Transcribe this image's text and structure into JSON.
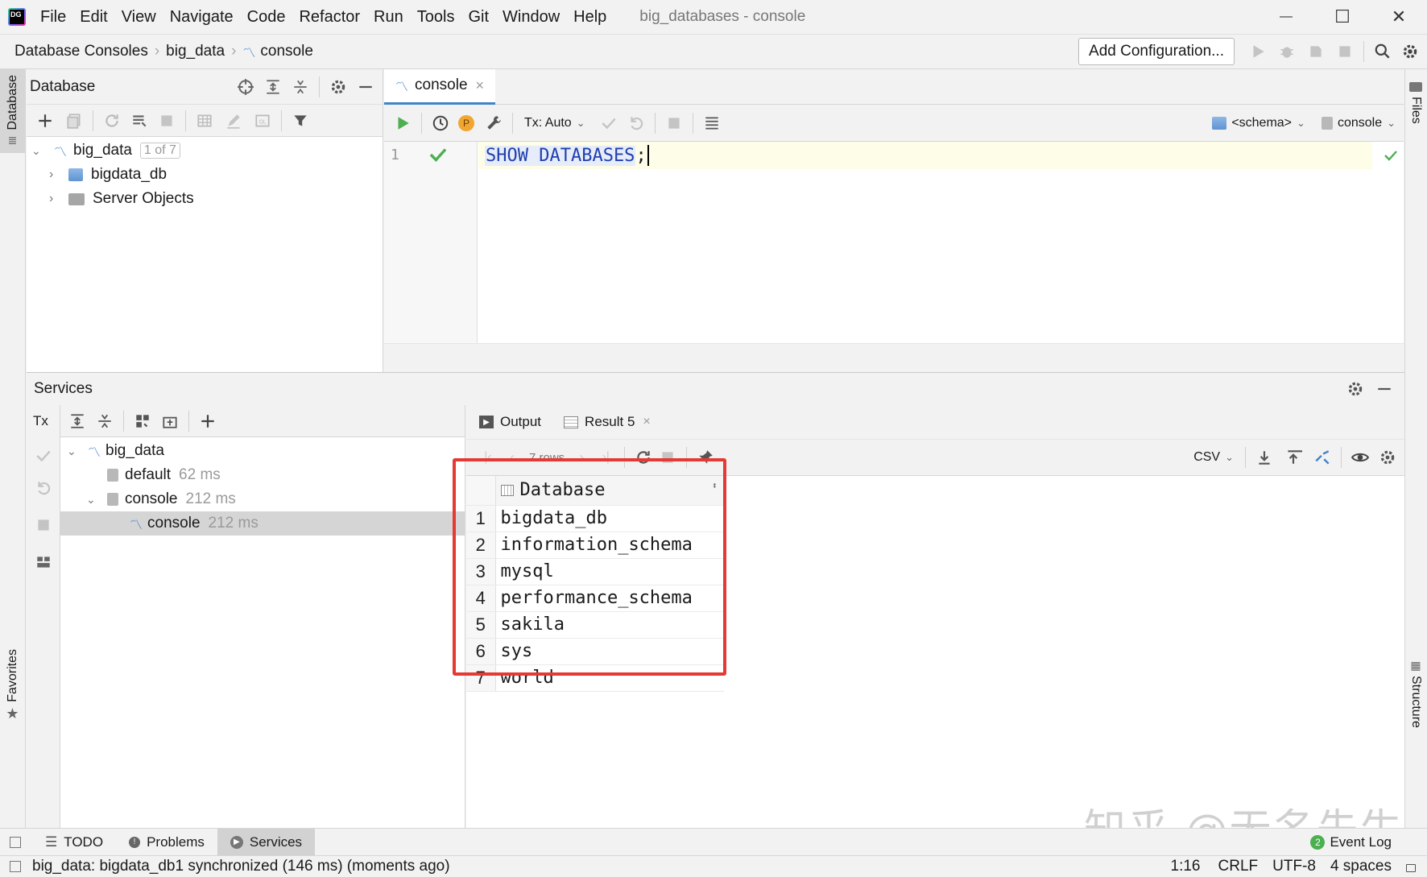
{
  "app": {
    "icon_text": "DG",
    "window_title": "big_databases - console",
    "menu": [
      "File",
      "Edit",
      "View",
      "Navigate",
      "Code",
      "Refactor",
      "Run",
      "Tools",
      "Git",
      "Window",
      "Help"
    ],
    "window_controls": {
      "minimize": "—",
      "maximize": "☐",
      "close": "✕"
    }
  },
  "navbar": {
    "breadcrumb": [
      "Database Consoles",
      "big_data",
      "console"
    ],
    "add_configuration": "Add Configuration..."
  },
  "left_strip": {
    "database": "Database",
    "favorites": "Favorites"
  },
  "right_strip": {
    "files": "Files",
    "structure": "Structure"
  },
  "db_panel": {
    "title": "Database",
    "tree": [
      {
        "label": "big_data",
        "badge": "1 of 7"
      },
      {
        "label": "bigdata_db"
      },
      {
        "label": "Server Objects"
      }
    ]
  },
  "editor": {
    "tab": "console",
    "tab_close": "×",
    "tx_mode": "Tx: Auto",
    "schema_selector": "<schema>",
    "console_selector": "console",
    "line_number": "1",
    "code": "SHOW DATABASES",
    "code_end": ";",
    "p_badge": "P"
  },
  "services": {
    "title": "Services",
    "tx_label": "Tx",
    "tree": [
      {
        "label": "big_data",
        "time": ""
      },
      {
        "label": "default",
        "time": "62 ms"
      },
      {
        "label": "console",
        "time": "212 ms"
      },
      {
        "label": "console",
        "time": "212 ms"
      }
    ],
    "result_tabs": {
      "output": "Output",
      "result": "Result 5",
      "result_close": "×"
    },
    "rows_label": "7 rows",
    "export_format": "CSV",
    "column_header": "Database",
    "rows": [
      {
        "n": "1",
        "v": "bigdata_db"
      },
      {
        "n": "2",
        "v": "information_schema"
      },
      {
        "n": "3",
        "v": "mysql"
      },
      {
        "n": "4",
        "v": "performance_schema"
      },
      {
        "n": "5",
        "v": "sakila"
      },
      {
        "n": "6",
        "v": "sys"
      },
      {
        "n": "7",
        "v": "world"
      }
    ]
  },
  "tool_tabs": {
    "todo": "TODO",
    "problems": "Problems",
    "services": "Services",
    "event_log": "Event Log",
    "event_count": "2"
  },
  "status": {
    "message": "big_data: bigdata_db1 synchronized (146 ms) (moments ago)",
    "position": "1:16",
    "line_sep": "CRLF",
    "encoding": "UTF-8",
    "indent": "4 spaces"
  },
  "watermark": "知乎 @无名先生",
  "colors": {
    "accent": "#4083c9",
    "run_green": "#4caf50",
    "highlight_red": "#e53935",
    "keyword_blue": "#1f3fae"
  }
}
